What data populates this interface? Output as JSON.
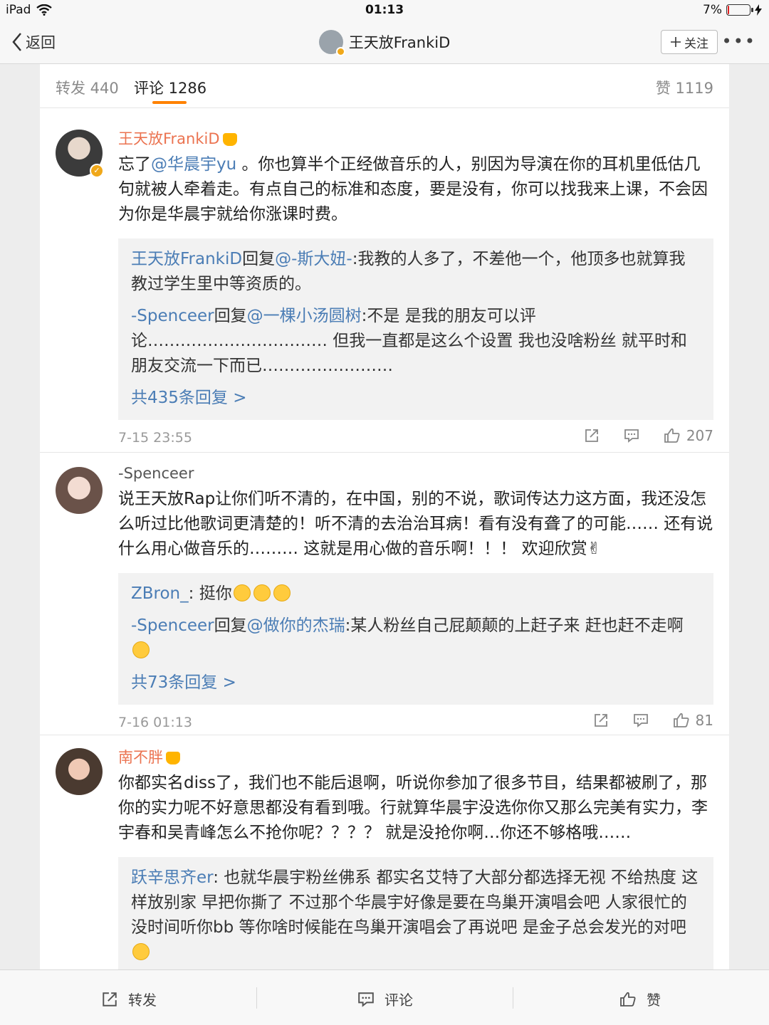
{
  "status_bar": {
    "device": "iPad",
    "time": "01:13",
    "battery_text": "7%",
    "battery_level": 0.07
  },
  "nav": {
    "back_label": "返回",
    "title": "王天放FrankiD",
    "follow_label": "关注",
    "more_label": "•••"
  },
  "tabs": {
    "repost": "转发 440",
    "comments": "评论 1286",
    "likes": "赞 1119"
  },
  "comments": [
    {
      "author": "王天放FrankiD",
      "text_prefix": "忘了",
      "text_mention": "@华晨宇yu",
      "text_suffix": " 。你也算半个正经做音乐的人，别因为导演在你的耳机里低估几句就被人牵着走。有点自己的标准和态度，要是没有，你可以找我来上课，不会因为你是华晨宇就给你涨课时费。",
      "replies": [
        {
          "name": "王天放FrankiD",
          "mid": "回复",
          "mention": "@-斯大妞-",
          "text": ":我教的人多了，不差他一个，他顶多也就算我教过学生里中等资质的。"
        },
        {
          "name": "-Spenceer",
          "mid": "回复",
          "mention": "@一棵小汤圆树",
          "text": ":不是 是我的朋友可以评论…………………………… 但我一直都是这么个设置 我也没啥粉丝 就平时和朋友交流一下而已……………………"
        }
      ],
      "more_replies": "共435条回复 >",
      "date": "7-15 23:55",
      "like_count": "207"
    },
    {
      "author": "-Spenceer",
      "text": "说王天放Rap让你们听不清的，在中国，别的不说，歌词传达力这方面，我还没怎么听过比他歌词更清楚的！听不清的去治治耳病！看有没有聋了的可能…… 还有说什么用心做音乐的……… 这就是用心做的音乐啊！！！ 欢迎欣赏✌",
      "replies": [
        {
          "name": "ZBron_",
          "text": ": 挺你"
        },
        {
          "name": "-Spenceer",
          "mid": "回复",
          "mention": "@做你的杰瑞",
          "text": ":某人粉丝自己屁颠颠的上赶子来 赶也赶不走啊"
        }
      ],
      "more_replies": "共73条回复 >",
      "date": "7-16 01:13",
      "like_count": "81"
    },
    {
      "author": "南不胖",
      "text": "你都实名diss了，我们也不能后退啊，听说你参加了很多节目，结果都被刷了，那你的实力呢不好意思都没有看到哦。行就算华晨宇没选你你又那么完美有实力，李宇春和吴青峰怎么不抢你呢？？？？ 就是没抢你啊…你还不够格哦……",
      "replies": [
        {
          "name": "跃辛思齐er",
          "text": ": 也就华晨宇粉丝佛系 都实名艾特了大部分都选择无视 不给热度 这样放别家 早把你撕了 不过那个华晨宇好像是要在鸟巢开演唱会吧 人家很忙的 没时间听你bb 等你啥时候能在鸟巢开演唱会了再说吧 是金子总会发光的对吧"
        }
      ]
    }
  ],
  "toolbar": {
    "repost": "转发",
    "comment": "评论",
    "like": "赞"
  }
}
